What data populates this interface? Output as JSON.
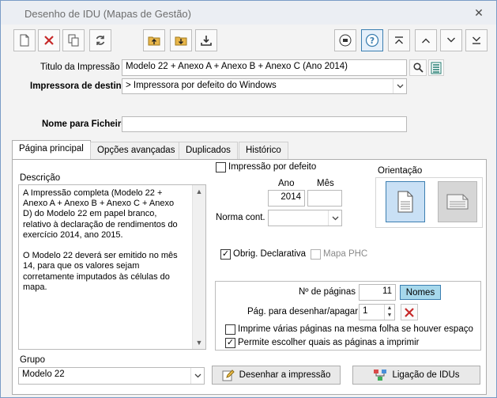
{
  "window": {
    "title": "Desenho de IDU (Mapas de Gestão)",
    "close_glyph": "✕"
  },
  "toolbar": {
    "left_icons": [
      "new-document-icon",
      "delete-icon",
      "copy-icon",
      "refresh-icon"
    ],
    "mid_icons": [
      "upload-icon",
      "download-folder-icon",
      "download-icon"
    ],
    "right_icons": [
      "printer-icon",
      "help-icon",
      "first-icon",
      "previous-icon",
      "next-icon",
      "last-icon"
    ]
  },
  "header": {
    "titulo_label": "Titulo da Impressão",
    "titulo_value": "Modelo 22 + Anexo A + Anexo B + Anexo C (Ano 2014)",
    "impressora_label": "Impressora de destino",
    "impressora_value": "> Impressora por defeito do Windows",
    "ficheiro_label": "Nome para Ficheiro",
    "ficheiro_value": ""
  },
  "tabs": [
    {
      "label": "Página principal",
      "active": true
    },
    {
      "label": "Opções avançadas",
      "active": false
    },
    {
      "label": "Duplicados",
      "active": false
    },
    {
      "label": "Histórico",
      "active": false
    }
  ],
  "main": {
    "descricao_label": "Descrição",
    "descricao_text": "A Impressão completa (Modelo 22 +\nAnexo A + Anexo B + Anexo C + Anexo\nD) do Modelo 22 em papel branco,\nrelativo à declaração de rendimentos do\nexercício 2014, ano 2015.\n\nO Modelo 22 deverá ser emitido no mês\n14, para que os valores sejam\ncorretamente imputados às células do\nmapa.",
    "impressao_defeito_label": "Impressão por defeito",
    "ano_label": "Ano",
    "mes_label": "Mês",
    "ano_value": "2014",
    "mes_value": "",
    "norma_label": "Norma cont.",
    "norma_value": "",
    "orientacao_label": "Orientação",
    "obrig_label": "Obrig. Declarativa",
    "mapa_phc_label": "Mapa PHC",
    "n_paginas_label": "Nº de páginas",
    "n_paginas_value": "11",
    "nomes_label": "Nomes",
    "pag_desenhar_label": "Pág. para desenhar/apagar",
    "pag_desenhar_value": "1",
    "imprime_varias_label": "Imprime várias páginas na mesma folha se houver espaço",
    "permite_escolher_label": "Permite escolher quais as páginas a imprimir",
    "grupo_label": "Grupo",
    "grupo_value": "Modelo 22",
    "desenhar_button": "Desenhar a impressão",
    "ligacao_button": "Ligação de IDUs"
  },
  "colors": {
    "accent": "#3c7fb1",
    "nomes_bg": "#a6d8ec",
    "delete_red": "#c62828"
  }
}
